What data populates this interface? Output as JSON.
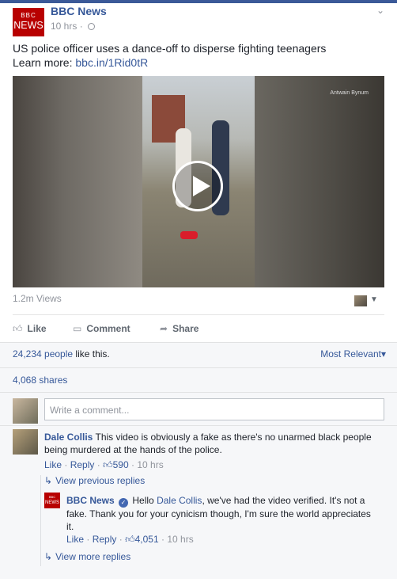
{
  "post": {
    "page_name": "BBC News",
    "logo_top": "BBC",
    "logo_bottom": "NEWS",
    "time": "10 hrs",
    "text": "US police officer uses a dance-off to disperse fighting teenagers",
    "learn_more_label": "Learn more:",
    "learn_more_link": "bbc.in/1Rid0tR"
  },
  "video": {
    "watermark": "Antwain Bynum",
    "play_icon": "play-icon",
    "views": "1.2m Views"
  },
  "actions": {
    "like": "Like",
    "comment": "Comment",
    "share": "Share"
  },
  "stats": {
    "likes_count": "24,234 people",
    "likes_suffix": " like this.",
    "sort_label": "Most Relevant",
    "shares": "4,068 shares"
  },
  "composer": {
    "placeholder": "Write a comment..."
  },
  "comment": {
    "author": "Dale Collis",
    "text": "This video is obviously a fake as there's no unarmed black people being murdered at the hands of the police.",
    "like": "Like",
    "reply": "Reply",
    "likes": "590",
    "time": "10 hrs"
  },
  "replies": {
    "view_previous": "View previous replies",
    "author": "BBC News",
    "greeting": "Hello",
    "mention": "Dale Collis",
    "text": ", we've had the video verified. It's not a fake. Thank you for your cynicism though, I'm sure the world appreciates it.",
    "like": "Like",
    "reply": "Reply",
    "likes": "4,051",
    "time": "10 hrs",
    "view_more": "View more replies"
  },
  "colors": {
    "brand_blue": "#365899",
    "bbc_red": "#b80000",
    "topbar": "#3b5998"
  }
}
